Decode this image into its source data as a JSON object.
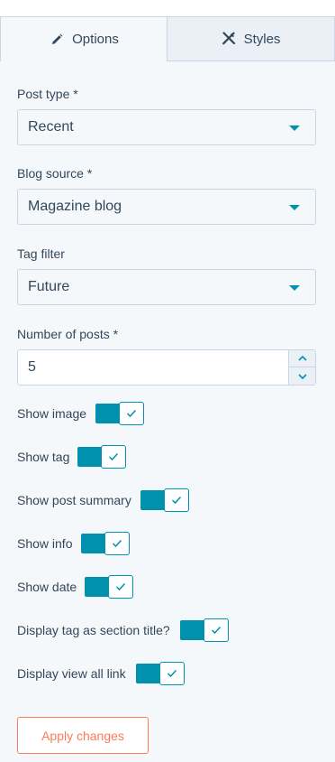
{
  "colors": {
    "accent": "#0091ae",
    "cta": "#ff7a59",
    "text": "#33475b",
    "border": "#cbd6e2"
  },
  "tabs": [
    {
      "label": "Options",
      "icon": "pencil-icon",
      "active": true
    },
    {
      "label": "Styles",
      "icon": "brush-icon",
      "active": false
    }
  ],
  "fields": {
    "post_type": {
      "label": "Post type *",
      "value": "Recent"
    },
    "blog_source": {
      "label": "Blog source *",
      "value": "Magazine blog"
    },
    "tag_filter": {
      "label": "Tag filter",
      "value": "Future"
    },
    "number_of_posts": {
      "label": "Number of posts *",
      "value": "5"
    }
  },
  "toggles": [
    {
      "label": "Show image",
      "on": true
    },
    {
      "label": "Show tag",
      "on": true
    },
    {
      "label": "Show post summary",
      "on": true
    },
    {
      "label": "Show info",
      "on": true
    },
    {
      "label": "Show date",
      "on": true
    },
    {
      "label": "Display tag as section title?",
      "on": true
    },
    {
      "label": "Display view all link",
      "on": true
    }
  ],
  "apply_button": {
    "label": "Apply changes"
  }
}
